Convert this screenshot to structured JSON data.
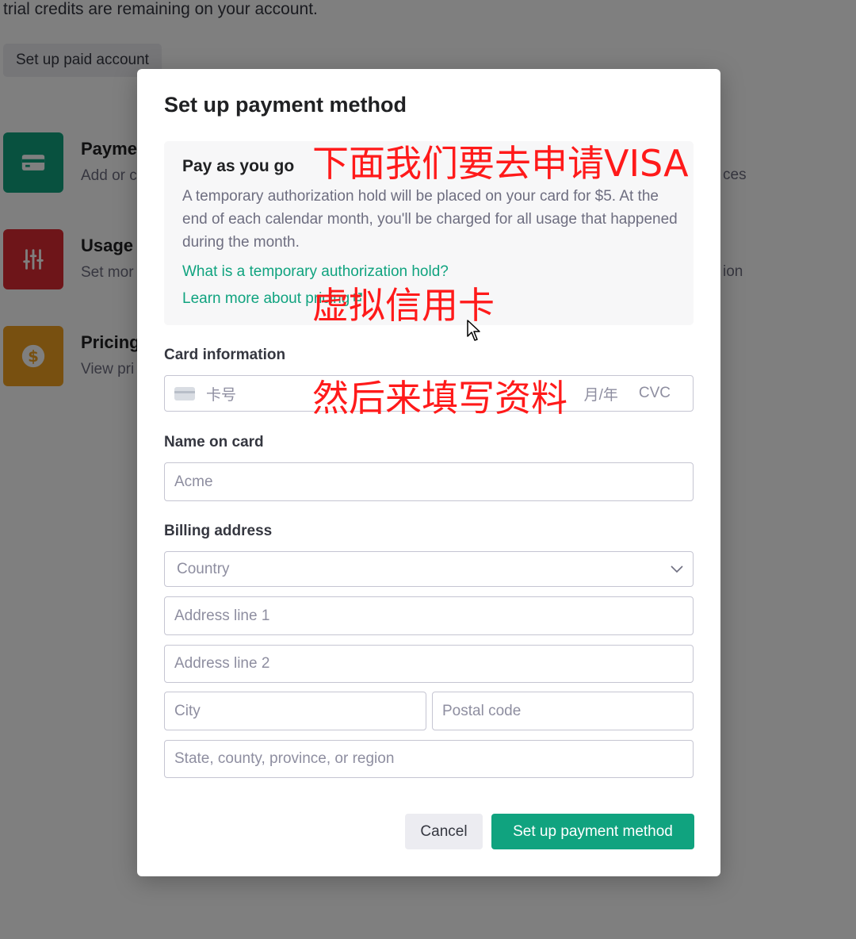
{
  "background": {
    "trial_text": "trial credits are remaining on your account.",
    "paid_button": "Set up paid account",
    "cards": [
      {
        "title": "Payme",
        "subtitle": "Add or c",
        "icon": "credit-card-icon",
        "color": "#10a37f"
      },
      {
        "title": "Usage",
        "subtitle": "Set mor",
        "icon": "sliders-icon",
        "color": "#dd2b32"
      },
      {
        "title": "Pricing",
        "subtitle": "View pri",
        "icon": "dollar-icon",
        "color": "#f0a020"
      }
    ],
    "right_fragments": [
      "ces",
      "ion"
    ]
  },
  "modal": {
    "title": "Set up payment method",
    "info": {
      "title": "Pay as you go",
      "description": "A temporary authorization hold will be placed on your card for $5. At the end of each calendar month, you'll be charged for all usage that happened during the month.",
      "link_hold": "What is a temporary authorization hold?",
      "link_pricing": "Learn more about pricing"
    },
    "card_label": "Card information",
    "card_placeholder": "卡号",
    "expiry_placeholder": "月/年",
    "cvc_placeholder": "CVC",
    "name_label": "Name on card",
    "name_placeholder": "Acme",
    "billing_label": "Billing address",
    "country_placeholder": "Country",
    "address1_placeholder": "Address line 1",
    "address2_placeholder": "Address line 2",
    "city_placeholder": "City",
    "postal_placeholder": "Postal code",
    "state_placeholder": "State, county, province, or region",
    "cancel_label": "Cancel",
    "submit_label": "Set up payment method"
  },
  "annotations": {
    "line1": "下面我们要去申请VISA",
    "line2": "虚拟信用卡",
    "line3": "然后来填写资料"
  },
  "colors": {
    "accent": "#10a37f",
    "annotation": "#ff1a1a"
  }
}
